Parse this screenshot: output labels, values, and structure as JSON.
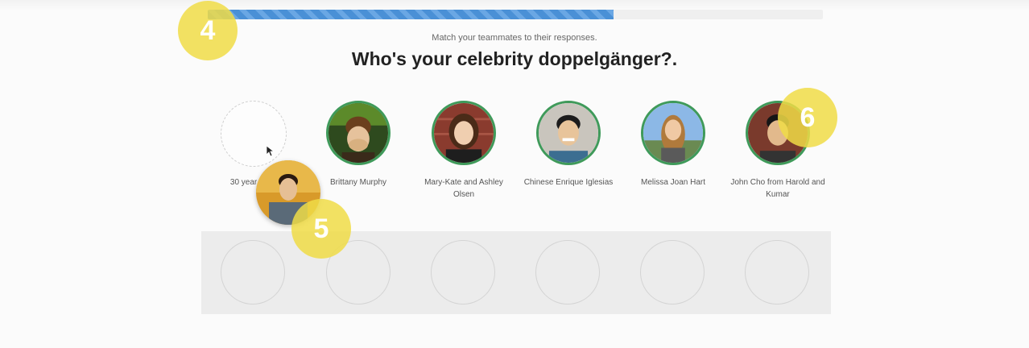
{
  "progress": {
    "percent": 66
  },
  "header": {
    "subtitle": "Match your teammates to their responses.",
    "question": "Who's your celebrity doppelgänger?."
  },
  "responses": [
    {
      "label": "30 year old T",
      "avatar": "empty-drop-slot"
    },
    {
      "label": "Brittany Murphy",
      "avatar": "teammate-photo"
    },
    {
      "label": "Mary-Kate and Ashley Olsen",
      "avatar": "teammate-photo"
    },
    {
      "label": "Chinese Enrique Iglesias",
      "avatar": "teammate-photo"
    },
    {
      "label": "Melissa Joan Hart",
      "avatar": "teammate-photo"
    },
    {
      "label": "John Cho from Harold and Kumar",
      "avatar": "teammate-photo"
    }
  ],
  "badges": {
    "b4": "4",
    "b5": "5",
    "b6": "6"
  },
  "colors": {
    "accent_green": "#3f9a5a",
    "progress_blue": "#4a90d6",
    "badge_yellow": "#f0dc46"
  }
}
